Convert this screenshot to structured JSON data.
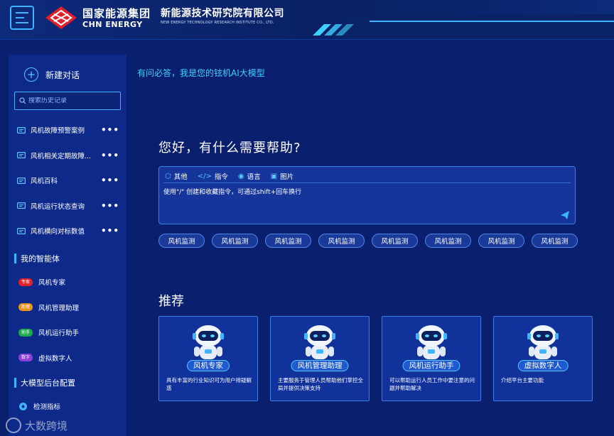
{
  "header": {
    "brand_cn": "国家能源集团",
    "brand_en": "CHN ENERGY",
    "org_cn": "新能源技术研究院有限公司",
    "org_en": "NEW ENERGY TECHNOLOGY RESEARCH INSTITUTE CO., LTD."
  },
  "sidebar": {
    "new_chat_label": "新建对话",
    "search_placeholder": "搜索历史记录",
    "history": [
      {
        "label": "风机故障预警案例",
        "more": "•••"
      },
      {
        "label": "风机相关定期故障...",
        "more": "•••"
      },
      {
        "label": "风机百科",
        "more": "•••"
      },
      {
        "label": "风机运行状态查询",
        "more": "•••"
      },
      {
        "label": "风机横向对标数值",
        "more": "•••"
      }
    ],
    "agents_title": "我的智能体",
    "agents": [
      {
        "tag": "专家",
        "label": "风机专家",
        "color": "#e0202a"
      },
      {
        "tag": "助理",
        "label": "风机管理助理",
        "color": "#e8921e"
      },
      {
        "tag": "助手",
        "label": "风机运行助手",
        "color": "#1fa84a"
      },
      {
        "tag": "数字",
        "label": "虚拟数字人",
        "color": "#8b3fd6"
      }
    ],
    "config_title": "大模型后台配置",
    "config_items": [
      {
        "label": "检测指标"
      }
    ]
  },
  "main": {
    "subtitle": "有问必答，我是您的铉机AI大模型",
    "greeting": "您好，有什么需要帮助?",
    "toolbar": [
      {
        "icon": "cube-icon",
        "glyph": "⬡",
        "label": "其他"
      },
      {
        "icon": "code-icon",
        "glyph": "</>",
        "label": "指令"
      },
      {
        "icon": "voice-icon",
        "glyph": "◉",
        "label": "语言"
      },
      {
        "icon": "image-icon",
        "glyph": "▣",
        "label": "图片"
      }
    ],
    "prompt_text": "使用\"/\" 创建和收藏指令，可通过shift+回车换行",
    "quick_chips": [
      "风机监测",
      "风机监测",
      "风机监测",
      "风机监测",
      "风机监测",
      "风机监测",
      "风机监测",
      "风机监测"
    ],
    "recommend_title": "推荐",
    "cards": [
      {
        "name": "风机专家",
        "desc": "具有丰富的行业知识可为用户排疑解惑"
      },
      {
        "name": "风机管理助理",
        "desc": "主要服务于管理人员帮助他们掌控全局并提供决策支持"
      },
      {
        "name": "风机运行助手",
        "desc": "可以帮助运行人员工作中要注意的问题并帮助解决"
      },
      {
        "name": "虚拟数字人",
        "desc": "介绍平台主要功能"
      }
    ]
  },
  "watermark": "大数跨境",
  "colors": {
    "background": "#0a1f6e",
    "sidebar": "#0d2a8a",
    "accent": "#3fb4ff",
    "subtitle": "#3fd0ff"
  }
}
